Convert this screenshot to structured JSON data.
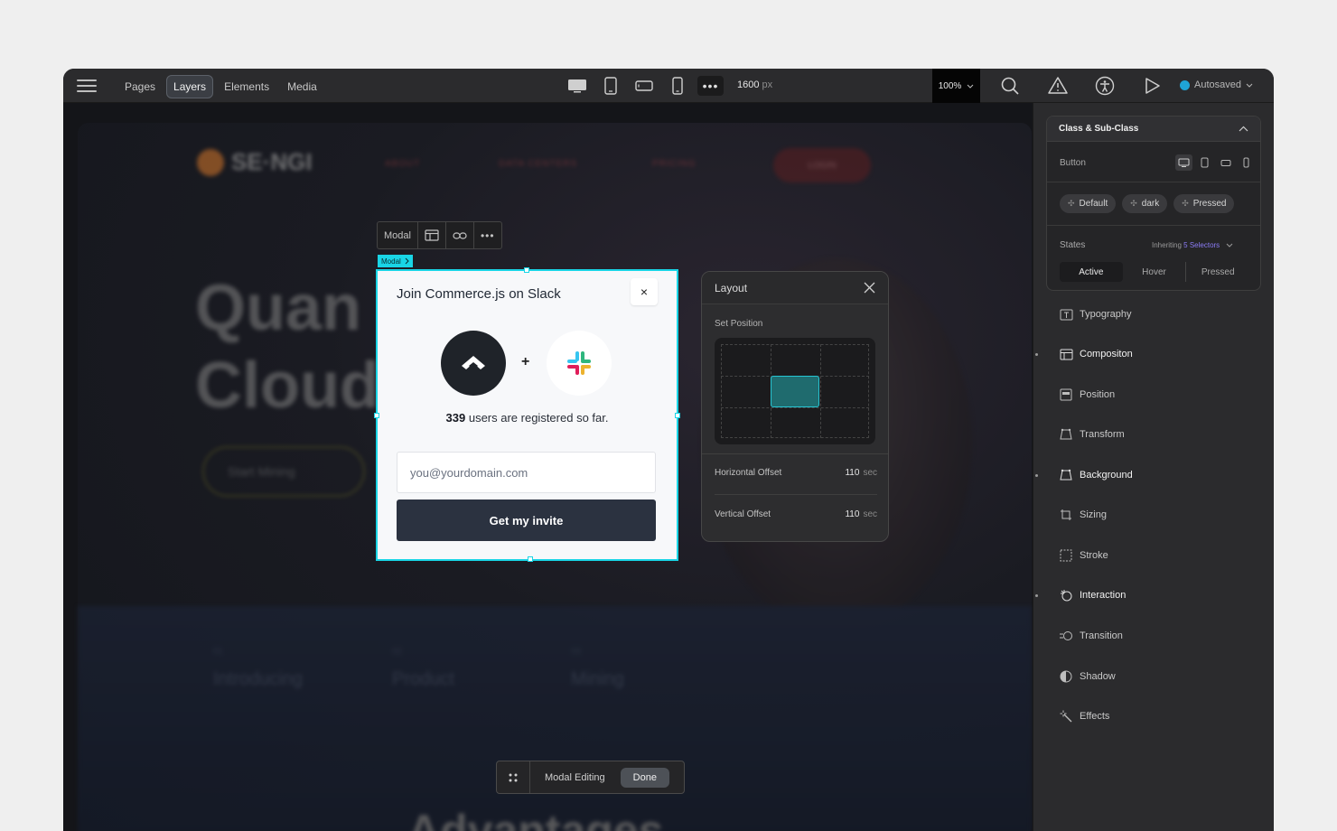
{
  "topbar": {
    "tabs": [
      {
        "label": "Pages",
        "active": false
      },
      {
        "label": "Layers",
        "active": true
      },
      {
        "label": "Elements",
        "active": false
      },
      {
        "label": "Media",
        "active": false
      }
    ],
    "devices": [
      "desktop-icon",
      "tablet-icon",
      "tablet-landscape-icon",
      "mobile-icon",
      "more-icon"
    ],
    "canvas_width": "1600",
    "canvas_width_unit": "px",
    "zoom": "100%",
    "autosave_label": "Autosaved"
  },
  "site": {
    "logo": "SE·NGI",
    "nav": [
      "ABOUT",
      "DATA CENTERS",
      "PRICING"
    ],
    "login": "LOGIN",
    "hero_line1": "Quan",
    "hero_line2": "Cloud",
    "cta": "Start Mining",
    "strip": [
      {
        "num": "01",
        "label": "Introducing"
      },
      {
        "num": "02",
        "label": "Product"
      },
      {
        "num": "03",
        "label": "Mining"
      }
    ],
    "advantages": "Advantages"
  },
  "modal_toolbar": {
    "label": "Modal",
    "tag": "Modal"
  },
  "modal": {
    "title": "Join Commerce.js on Slack",
    "close": "×",
    "plus": "+",
    "user_count": "339",
    "users_text": "users are registered so far.",
    "email_placeholder": "you@yourdomain.com",
    "invite_button": "Get my invite"
  },
  "layout_popover": {
    "title": "Layout",
    "set_position": "Set Position",
    "horizontal_label": "Horizontal Offset",
    "horizontal_value": "110",
    "horizontal_unit": "sec",
    "vertical_label": "Vertical Offset",
    "vertical_value": "110",
    "vertical_unit": "sec"
  },
  "edit_pill": {
    "label": "Modal Editing",
    "done": "Done"
  },
  "panel": {
    "class_title": "Class & Sub-Class",
    "element_label": "Button",
    "chips": [
      "Default",
      "dark",
      "Pressed"
    ],
    "states_label": "States",
    "inheriting_text": "Inheriting",
    "selectors_link": "5 Selectors",
    "state_tabs": [
      "Active",
      "Hover",
      "Pressed"
    ],
    "properties": [
      {
        "label": "Typography",
        "bold": false,
        "icon": "typography-icon"
      },
      {
        "label": "Compositon",
        "bold": true,
        "icon": "composition-icon"
      },
      {
        "label": "Position",
        "bold": false,
        "icon": "position-icon"
      },
      {
        "label": "Transform",
        "bold": false,
        "icon": "transform-icon"
      },
      {
        "label": "Background",
        "bold": true,
        "icon": "background-icon"
      },
      {
        "label": "Sizing",
        "bold": false,
        "icon": "sizing-icon"
      },
      {
        "label": "Stroke",
        "bold": false,
        "icon": "stroke-icon"
      },
      {
        "label": "Interaction",
        "bold": true,
        "icon": "interaction-icon"
      },
      {
        "label": "Transition",
        "bold": false,
        "icon": "transition-icon"
      },
      {
        "label": "Shadow",
        "bold": false,
        "icon": "shadow-icon"
      },
      {
        "label": "Effects",
        "bold": false,
        "icon": "effects-icon"
      }
    ]
  },
  "colors": {
    "accent_selection": "#19d5e6",
    "selector_link": "#8b7cf6",
    "autosave_dot": "#1fa4d6"
  }
}
